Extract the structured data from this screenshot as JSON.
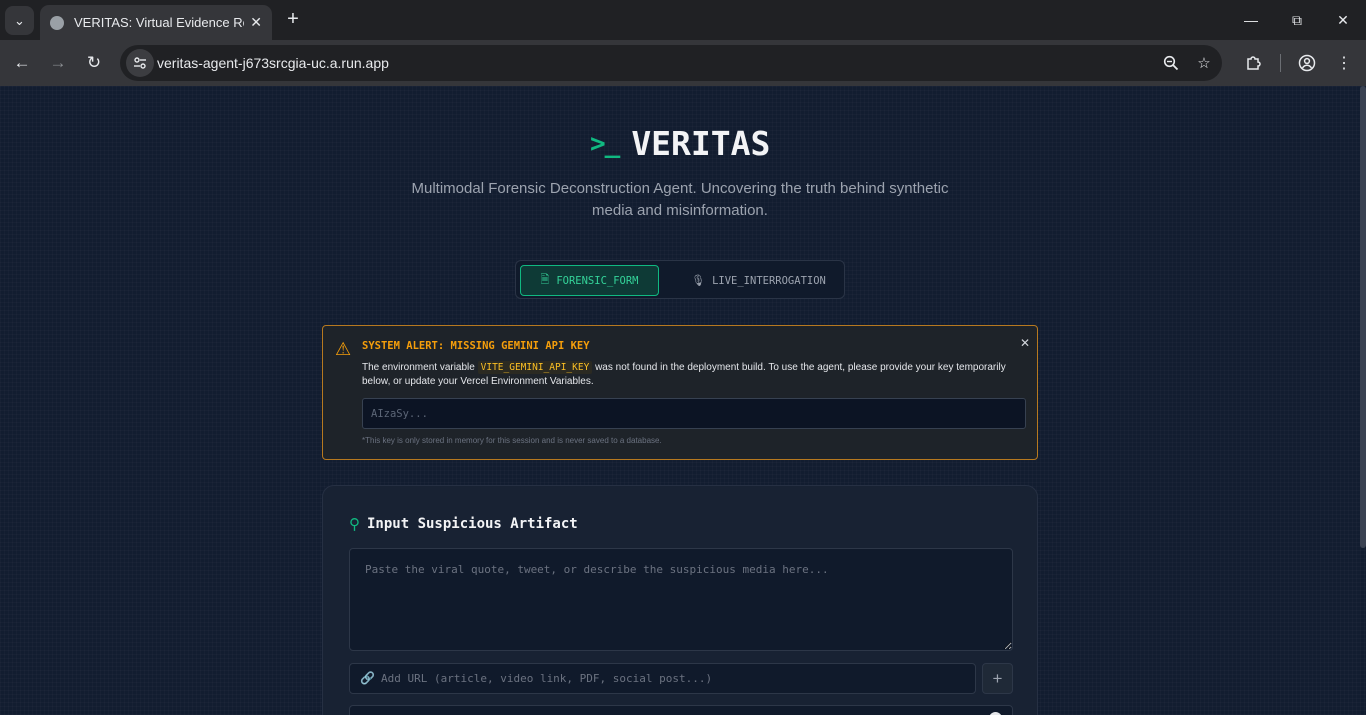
{
  "browser": {
    "tab_title": "VERITAS: Virtual Evidence Reconstruction",
    "url": "veritas-agent-j673srcgia-uc.a.run.app"
  },
  "header": {
    "prompt_symbol": ">_",
    "brand": "VERITAS",
    "subtitle": "Multimodal Forensic Deconstruction Agent. Uncovering the truth behind synthetic media and misinformation."
  },
  "modes": {
    "forensic_form": "FORENSIC_FORM",
    "live_interrogation": "LIVE_INTERROGATION",
    "active": "forensic_form"
  },
  "alert": {
    "title": "SYSTEM ALERT: MISSING GEMINI API KEY",
    "body_before": "The environment variable ",
    "env_var": "VITE_GEMINI_API_KEY",
    "body_after": " was not found in the deployment build. To use the agent, please provide your key temporarily below, or update your Vercel Environment Variables.",
    "key_placeholder": "AIzaSy...",
    "key_value": "",
    "note": "*This key is only stored in memory for this session and is never saved to a database."
  },
  "input_card": {
    "title": "Input Suspicious Artifact",
    "artifact_placeholder": "Paste the viral quote, tweet, or describe the suspicious media here...",
    "url_placeholder": "Add URL (article, video link, PDF, social post...)"
  },
  "colors": {
    "accent": "#10b981",
    "warning": "#f59e0b",
    "background": "#121d30"
  }
}
